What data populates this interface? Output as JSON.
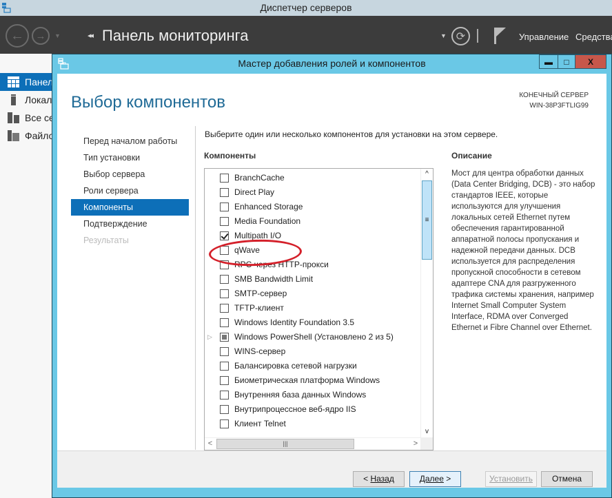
{
  "server_manager": {
    "window_title": "Диспетчер серверов",
    "header_title": "Панель мониторинга",
    "menu": {
      "manage": "Управление",
      "tools": "Средства"
    },
    "sidebar": [
      {
        "label": "Панель мониторинга",
        "icon": "dashboard-icon",
        "active": true
      },
      {
        "label": "Локальный сервер",
        "icon": "server-icon",
        "active": false
      },
      {
        "label": "Все серверы",
        "icon": "servers-icon",
        "active": false
      },
      {
        "label": "Файловые службы",
        "icon": "file-services-icon",
        "active": false
      }
    ]
  },
  "wizard": {
    "title": "Мастер добавления ролей и компонентов",
    "window_buttons": {
      "minimize": "▬",
      "maximize": "□",
      "close": "X"
    },
    "page_title": "Выбор компонентов",
    "destination_label": "КОНЕЧНЫЙ СЕРВЕР",
    "destination_server": "WIN-38P3FTLIG99",
    "steps": [
      {
        "label": "Перед началом работы",
        "state": "normal"
      },
      {
        "label": "Тип установки",
        "state": "normal"
      },
      {
        "label": "Выбор сервера",
        "state": "normal"
      },
      {
        "label": "Роли сервера",
        "state": "normal"
      },
      {
        "label": "Компоненты",
        "state": "active"
      },
      {
        "label": "Подтверждение",
        "state": "normal"
      },
      {
        "label": "Результаты",
        "state": "disabled"
      }
    ],
    "instruction": "Выберите один или несколько компонентов для установки на этом сервере.",
    "components_heading": "Компоненты",
    "description_heading": "Описание",
    "components": [
      {
        "label": "BranchCache",
        "state": "unchecked",
        "expandable": false
      },
      {
        "label": "Direct Play",
        "state": "unchecked",
        "expandable": false
      },
      {
        "label": "Enhanced Storage",
        "state": "unchecked",
        "expandable": false
      },
      {
        "label": "Media Foundation",
        "state": "unchecked",
        "expandable": false
      },
      {
        "label": "Multipath I/O",
        "state": "checked",
        "expandable": false
      },
      {
        "label": "qWave",
        "state": "unchecked",
        "expandable": false
      },
      {
        "label": "RPC через HTTP-прокси",
        "state": "unchecked",
        "expandable": false
      },
      {
        "label": "SMB Bandwidth Limit",
        "state": "unchecked",
        "expandable": false
      },
      {
        "label": "SMTP-сервер",
        "state": "unchecked",
        "expandable": false
      },
      {
        "label": "TFTP-клиент",
        "state": "unchecked",
        "expandable": false
      },
      {
        "label": "Windows Identity Foundation 3.5",
        "state": "unchecked",
        "expandable": false
      },
      {
        "label": "Windows PowerShell (Установлено 2 из 5)",
        "state": "partial",
        "expandable": true
      },
      {
        "label": "WINS-сервер",
        "state": "unchecked",
        "expandable": false
      },
      {
        "label": "Балансировка сетевой нагрузки",
        "state": "unchecked",
        "expandable": false
      },
      {
        "label": "Биометрическая платформа Windows",
        "state": "unchecked",
        "expandable": false
      },
      {
        "label": "Внутренняя база данных Windows",
        "state": "unchecked",
        "expandable": false
      },
      {
        "label": "Внутрипроцессное веб-ядро IIS",
        "state": "unchecked",
        "expandable": false
      },
      {
        "label": "Клиент Telnet",
        "state": "unchecked",
        "expandable": false
      }
    ],
    "description": "Мост для центра обработки данных (Data Center Bridging, DCB) - это набор стандартов IEEE, которые используются для улучшения локальных сетей Ethernet путем обеспечения гарантированной аппаратной полосы пропускания и надежной передачи данных. DCB используется для распределения пропускной способности в сетевом адаптере CNA для разгруженного трафика системы хранения, например Internet Small Computer System Interface, RDMA over Converged Ethernet и Fibre Channel over Ethernet.",
    "buttons": {
      "back_prefix": "< ",
      "back": "Назад",
      "next": "Далее",
      "next_suffix": " >",
      "install": "Установить",
      "cancel": "Отмена"
    }
  },
  "colors": {
    "accent": "#0d6fb8",
    "wizard_frame": "#6ac8e6",
    "title_blue": "#1f6a96",
    "highlight_oval": "#d4202a",
    "close_button": "#c7574b"
  }
}
